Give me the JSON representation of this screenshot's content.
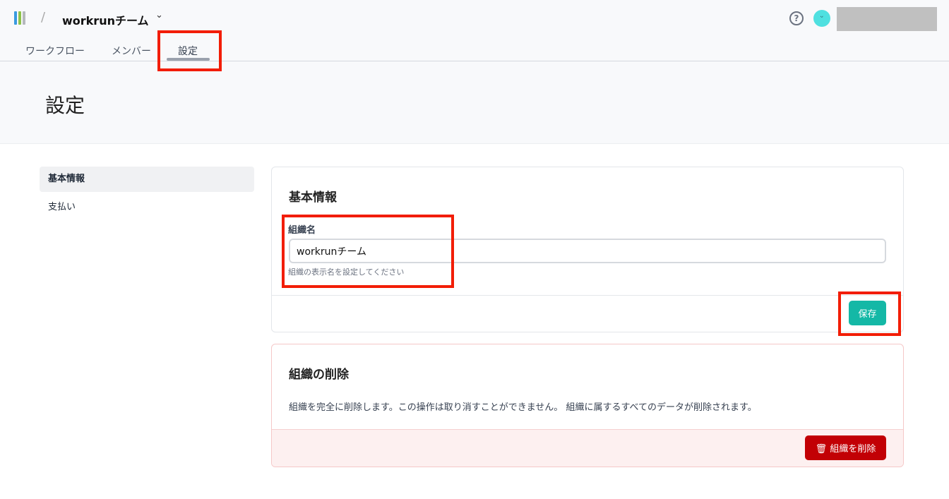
{
  "header": {
    "team_name": "workrunチーム",
    "help": "?",
    "tabs": [
      "ワークフロー",
      "メンバー",
      "設定"
    ]
  },
  "page_title": "設定",
  "sidebar": {
    "items": [
      "基本情報",
      "支払い"
    ]
  },
  "basic": {
    "title": "基本情報",
    "field_label": "組織名",
    "field_value": "workrunチーム",
    "hint": "組織の表示名を設定してください",
    "save": "保存"
  },
  "danger": {
    "title": "組織の削除",
    "description": "組織を完全に削除します。この操作は取り消すことができません。 組織に属するすべてのデータが削除されます。",
    "delete": "組織を削除"
  },
  "colors": {
    "accent": "#14b8a6",
    "danger": "#c20005",
    "highlight": "#f21d05"
  }
}
